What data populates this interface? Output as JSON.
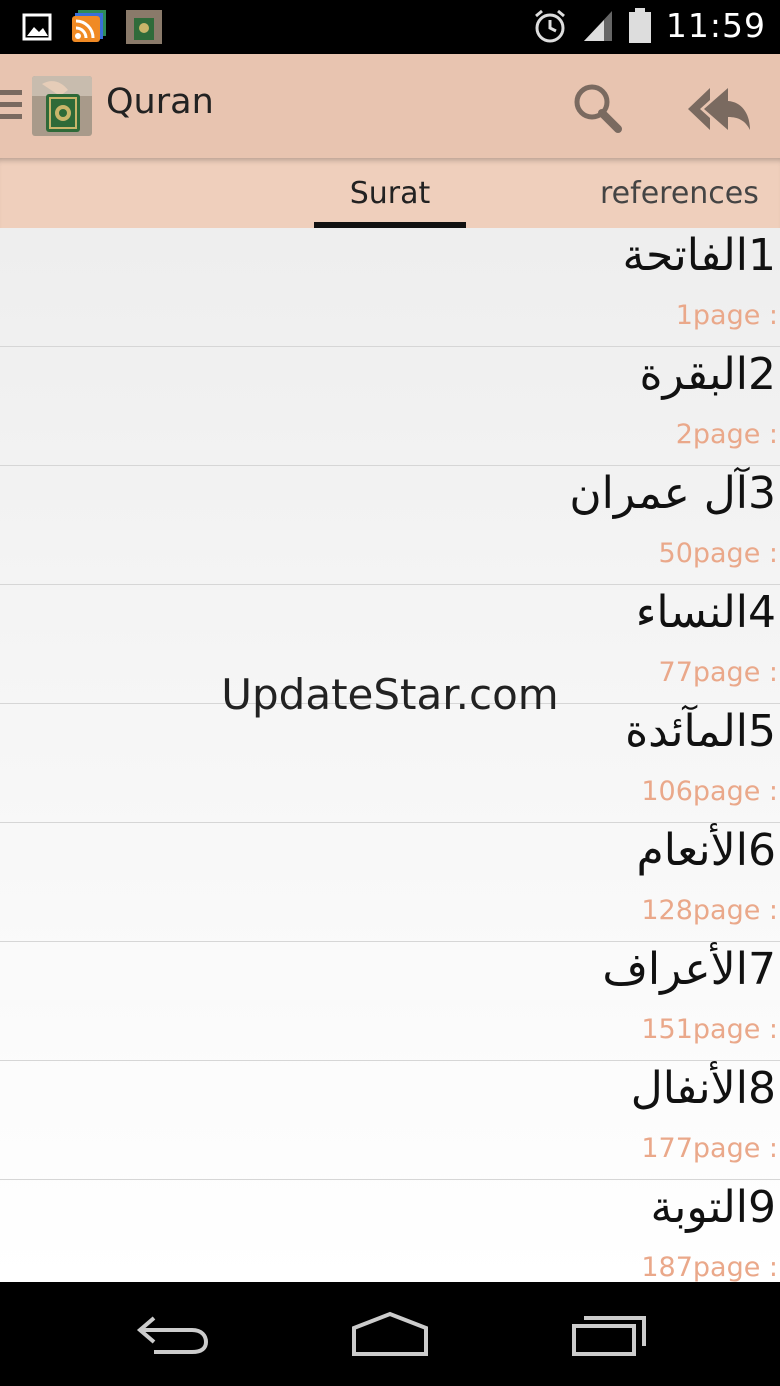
{
  "status_bar": {
    "time": "11:59",
    "left_icons": [
      "image-icon",
      "rss-icon",
      "quran-notification-icon"
    ],
    "right_icons": [
      "alarm-icon",
      "signal-icon",
      "battery-icon"
    ]
  },
  "action_bar": {
    "title": "Quran",
    "icons": [
      "menu-icon",
      "app-logo",
      "search-icon",
      "reply-all-icon"
    ],
    "background": "#e8c4b0"
  },
  "tabs": [
    {
      "label": "Surat",
      "selected": true
    },
    {
      "label": "references",
      "selected": false
    }
  ],
  "surahs": [
    {
      "title": "1الفاتحة",
      "page": "1page :"
    },
    {
      "title": "2البقرة",
      "page": "2page :"
    },
    {
      "title": "3آل عمران",
      "page": "50page :"
    },
    {
      "title": "4النساء",
      "page": "77page :"
    },
    {
      "title": "5المآئدة",
      "page": "106page :"
    },
    {
      "title": "6الأنعام",
      "page": "128page :"
    },
    {
      "title": "7الأعراف",
      "page": "151page :"
    },
    {
      "title": "8الأنفال",
      "page": "177page :"
    },
    {
      "title": "9التوبة",
      "page": "187page :"
    }
  ],
  "watermark": "UpdateStar.com",
  "colors": {
    "page_label": "#eaa88a",
    "tab_indicator": "#111111"
  },
  "nav_bar": {
    "icons": [
      "back-icon",
      "home-icon",
      "recents-icon"
    ]
  }
}
